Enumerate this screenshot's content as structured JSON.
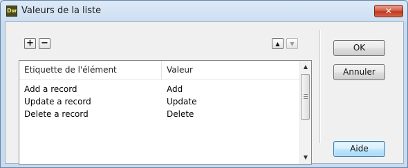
{
  "window": {
    "title": "Valeurs de la liste",
    "app_icon_text": "Dw",
    "close_glyph": "✕"
  },
  "toolbar": {
    "add_glyph": "+",
    "remove_glyph": "−",
    "move_up_glyph": "▲",
    "move_down_glyph": "▼"
  },
  "table": {
    "columns": [
      "Etiquette de l'élément",
      "Valeur"
    ],
    "rows": [
      {
        "label": "Add a record",
        "value": "Add"
      },
      {
        "label": "Update a record",
        "value": "Update"
      },
      {
        "label": "Delete a record",
        "value": "Delete"
      }
    ]
  },
  "buttons": {
    "ok": "OK",
    "cancel": "Annuler",
    "help": "Aide"
  },
  "scrollbar": {
    "up_glyph": "▲",
    "down_glyph": "▼"
  }
}
